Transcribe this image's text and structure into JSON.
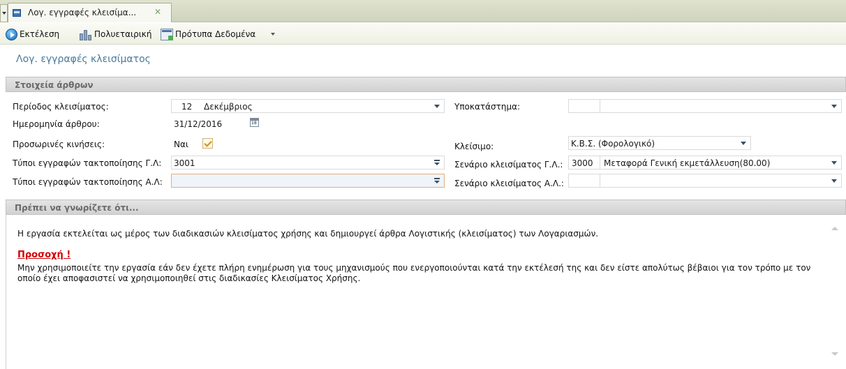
{
  "tab": {
    "title": "Λογ. εγγραφές κλεισίμα..."
  },
  "toolbar": {
    "run_label": "Εκτέλεση",
    "multi_label": "Πολυεταιρική",
    "template_label": "Πρότυπα Δεδομένα"
  },
  "page": {
    "title": "Λογ. εγγραφές κλεισίματος"
  },
  "articles_panel": {
    "title": "Στοιχεία άρθρων",
    "period_label": "Περίοδος κλεισίματος:",
    "period_num": "12",
    "period_month": "Δεκέμβριος",
    "branch_label": "Υποκατάστημα:",
    "branch_code": "",
    "branch_name": "",
    "date_label": "Ημερομηνία άρθρου:",
    "date_value": "31/12/2016",
    "temp_label": "Προσωρινές κινήσεις:",
    "temp_value": "Ναι",
    "closing_label": "Κλείσιμο:",
    "closing_value": "Κ.Β.Σ. (Φορολογικό)",
    "gl_types_label": "Τύποι εγγραφών τακτοποίησης Γ.Λ:",
    "gl_types_value": "3001",
    "gl_scenario_label": "Σενάριο κλεισίματος Γ.Λ.:",
    "gl_scenario_code": "3000",
    "gl_scenario_name": "Μεταφορά Γενική εκμετάλλευση(80.00)",
    "al_types_label": "Τύποι εγγραφών τακτοποίησης Α.Λ:",
    "al_types_value": "",
    "al_scenario_label": "Σενάριο κλεισίματος Α.Λ.:",
    "al_scenario_code": "",
    "al_scenario_name": ""
  },
  "info_panel": {
    "title": "Πρέπει να γνωρίζετε ότι...",
    "line1": "Η εργασία εκτελείται ως μέρος των διαδικασιών κλεισίματος χρήσης και δημιουργεί άρθρα Λογιστικής (κλεισίματος) των Λογαριασμών.",
    "warning": "Προσοχή !",
    "line2": "Μην χρησιμοποιείτε την εργασία εάν δεν έχετε πλήρη ενημέρωση για τους μηχανισμούς που ενεργοποιούνται κατά την εκτέλεσή της και δεν είστε απολύτως βέβαιοι για τον τρόπο με τον",
    "line3": "οποίο έχει αποφασιστεί να χρησιμοποιηθεί στις διαδικασίες Κλεισίματος Χρήσης."
  }
}
